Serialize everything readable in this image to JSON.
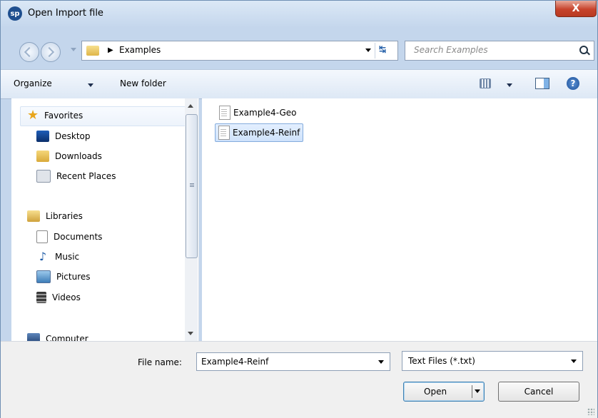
{
  "window": {
    "title": "Open Import file",
    "app_icon": "sp",
    "close_glyph": "X"
  },
  "nav": {
    "crumb": "Examples",
    "search_placeholder": "Search Examples"
  },
  "toolbar": {
    "organize": "Organize",
    "new_folder": "New folder"
  },
  "sidebar": {
    "favorites": "Favorites",
    "favorites_items": [
      "Desktop",
      "Downloads",
      "Recent Places"
    ],
    "libraries": "Libraries",
    "library_items": [
      "Documents",
      "Music",
      "Pictures",
      "Videos"
    ],
    "computer": "Computer"
  },
  "files": [
    "Example4-Geo",
    "Example4-Reinf"
  ],
  "selected_file": "Example4-Reinf",
  "bottom": {
    "file_name_label": "File name:",
    "file_name_value": "Example4-Reinf",
    "file_type_value": "Text Files (*.txt)",
    "open_label": "Open",
    "cancel_label": "Cancel"
  },
  "colors": {
    "title_bar": "#c4d6ec",
    "close_button": "#c7432c",
    "selection": "#cfe2fb",
    "favorites_star": "#e8a51a"
  },
  "icons": {
    "search": "search-icon",
    "help": "help-icon",
    "views": "views-icon",
    "preview_pane": "preview-pane-icon"
  }
}
